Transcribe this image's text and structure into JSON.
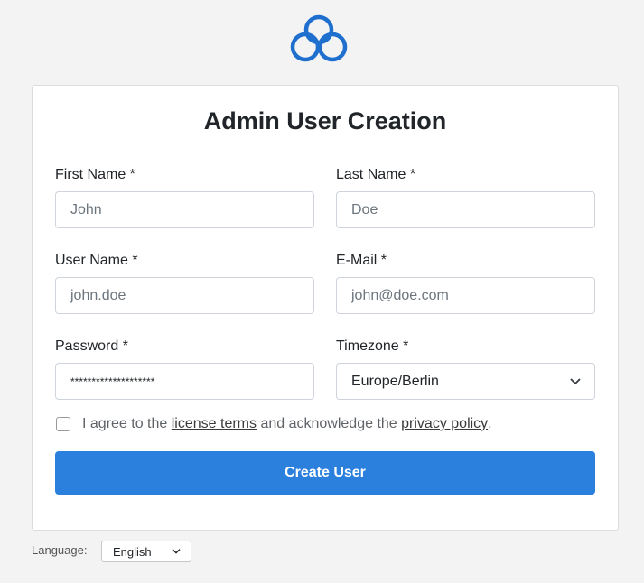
{
  "brand": {
    "color": "#1f6fce"
  },
  "form": {
    "title": "Admin User Creation",
    "first_name": {
      "label": "First Name *",
      "placeholder": "John"
    },
    "last_name": {
      "label": "Last Name *",
      "placeholder": "Doe"
    },
    "user_name": {
      "label": "User Name *",
      "placeholder": "john.doe"
    },
    "email": {
      "label": "E-Mail *",
      "placeholder": "john@doe.com"
    },
    "password": {
      "label": "Password *",
      "value": "********************"
    },
    "timezone": {
      "label": "Timezone *",
      "value": "Europe/Berlin"
    },
    "agree": {
      "prefix": "I agree to the",
      "license_link": "license terms",
      "middle": "and acknowledge the",
      "privacy_link": "privacy policy",
      "suffix": "."
    },
    "submit_label": "Create User"
  },
  "footer": {
    "language_label": "Language:",
    "language_value": "English"
  }
}
